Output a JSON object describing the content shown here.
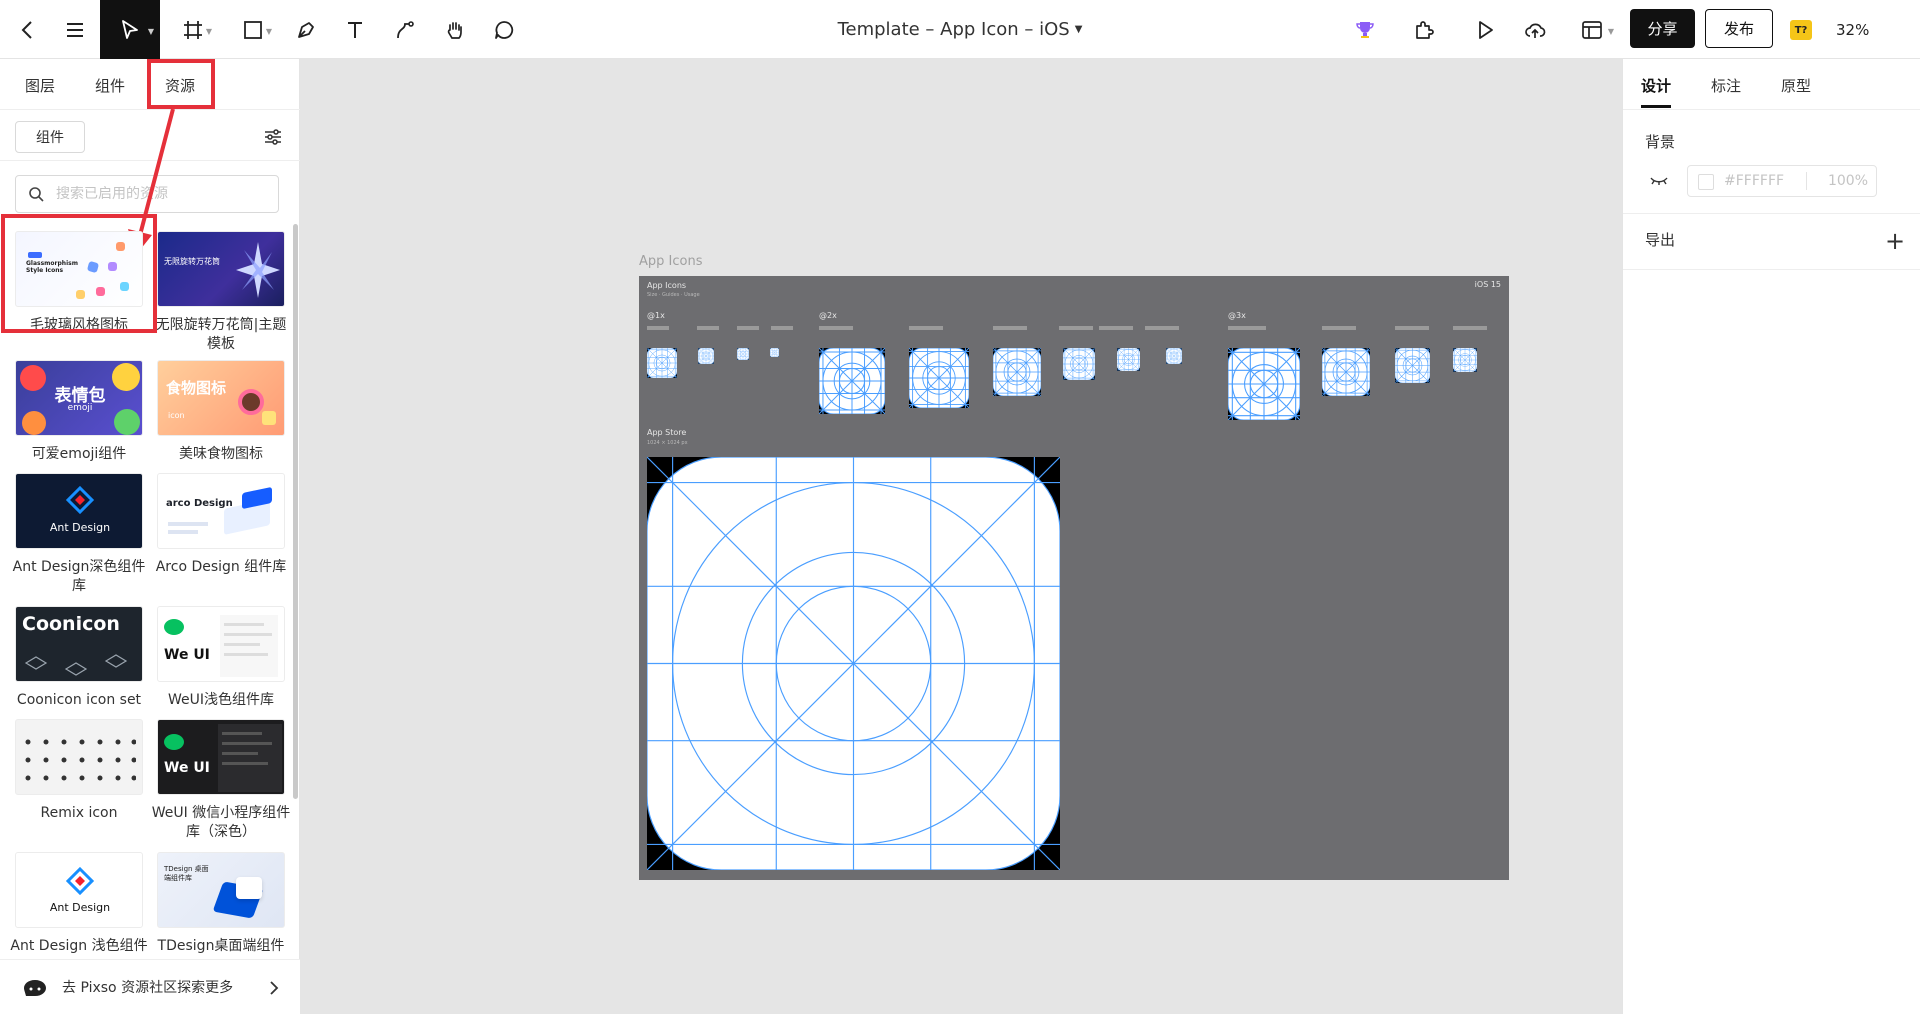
{
  "toolbar": {
    "document_title": "Template – App Icon – iOS",
    "share_label": "分享",
    "publish_label": "发布",
    "avatar_text": "T?",
    "zoom": "32%"
  },
  "left_panel": {
    "tabs": [
      "图层",
      "组件",
      "资源"
    ],
    "active_tab": "资源",
    "filter_chip": "组件",
    "search_placeholder": "搜索已启用的资源",
    "resources": [
      {
        "label": "毛玻璃风格图标",
        "thumb_text": "Glassmorphism Style Icons"
      },
      {
        "label": "无限旋转万花筒|主题模板",
        "thumb_text": "无限旋转万花筒"
      },
      {
        "label": "可爱emoji组件",
        "thumb_text": "表情包",
        "thumb_sub": "emoji"
      },
      {
        "label": "美味食物图标",
        "thumb_text": "食物图标",
        "thumb_sub": "icon"
      },
      {
        "label": "Ant Design深色组件库",
        "thumb_text": "Ant Design"
      },
      {
        "label": "Arco Design 组件库",
        "thumb_text": "arco Design"
      },
      {
        "label": "Coonicon icon set",
        "thumb_text": "Coonicon"
      },
      {
        "label": "WeUI浅色组件库",
        "thumb_text": "We UI"
      },
      {
        "label": "Remix icon",
        "thumb_text": ""
      },
      {
        "label": "WeUI 微信小程序组件库（深色）",
        "thumb_text": "We UI"
      },
      {
        "label": "Ant Design 浅色组件库",
        "thumb_text": "Ant Design"
      },
      {
        "label": "TDesign桌面端组件库",
        "thumb_text": "TDesign 桌面端组件库"
      }
    ],
    "bottom_link": "去 Pixso 资源社区探索更多"
  },
  "canvas": {
    "frame_label": "App Icons",
    "artboard": {
      "title": "App Icons",
      "subtitle": "Size · Guides · Usage",
      "badge": "iOS 15",
      "sections": [
        "@1x",
        "@2x",
        "@3x"
      ],
      "store_title": "App Store",
      "store_subtitle": "1024 × 1024 px"
    }
  },
  "right_panel": {
    "tabs": [
      "设计",
      "标注",
      "原型"
    ],
    "active_tab": "设计",
    "background_label": "背景",
    "background_hex": "#FFFFFF",
    "background_opacity": "100%",
    "export_label": "导出"
  },
  "colors": {
    "highlight": "#e5303a",
    "artboard_bg": "#6d6d70",
    "guide_line": "#4a9eff",
    "toolbar_active": "#111111"
  }
}
